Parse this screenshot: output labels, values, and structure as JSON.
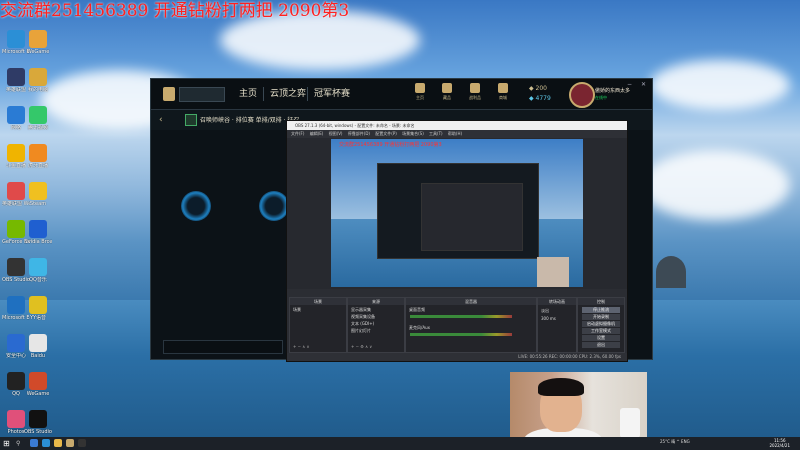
{
  "banner": "交流群251456389 开通钻粉打两把 2090第3",
  "desktop_icons": [
    {
      "label": "Microsoft Edge",
      "color": "#2b8fd6"
    },
    {
      "label": "WeGame",
      "color": "#e8a33a"
    },
    {
      "label": "英雄联盟",
      "color": "#2f3b66"
    },
    {
      "label": "我的电脑",
      "color": "#d9a83a"
    },
    {
      "label": "网络",
      "color": "#2a7bd4"
    },
    {
      "label": "腾讯视频",
      "color": "#34c86a"
    },
    {
      "label": "斗鱼直播",
      "color": "#f0b400"
    },
    {
      "label": "虎牙直播",
      "color": "#f08a20"
    },
    {
      "label": "英雄联盟 WeGame",
      "color": "#e04a4a"
    },
    {
      "label": "Steam",
      "color": "#f0c020"
    },
    {
      "label": "GeForce Experience",
      "color": "#76b900"
    },
    {
      "label": "Nvidia Broadcast",
      "color": "#1f5fd0"
    },
    {
      "label": "OBS Studio",
      "color": "#333333"
    },
    {
      "label": "QQ音乐",
      "color": "#3fb6e6"
    },
    {
      "label": "Microsoft Edge",
      "color": "#1f70c0"
    },
    {
      "label": "YY语音",
      "color": "#e0c020"
    },
    {
      "label": "安全中心",
      "color": "#2a6ad0"
    },
    {
      "label": "Baidu",
      "color": "#e6e6e6"
    },
    {
      "label": "QQ",
      "color": "#222222"
    },
    {
      "label": "WeGame",
      "color": "#d14a2a"
    },
    {
      "label": "Photos",
      "color": "#e0507a"
    },
    {
      "label": "OBS Studio",
      "color": "#111111"
    }
  ],
  "client": {
    "search_placeholder": "",
    "nav": [
      "主页",
      "云顶之弈",
      "冠军杯赛"
    ],
    "top_icons": [
      "主页",
      "藏品",
      "战利品",
      "商城"
    ],
    "currency_blue": "200",
    "currency_orange": "4779",
    "player_name": "傲娇的东西太多",
    "player_status": "在线中",
    "mode_title": "召唤师峡谷 · 排位赛 单排/双排 · 征召",
    "chat_label": ""
  },
  "obs": {
    "title": "OBS 27.1.3 (64-bit, windows) - 配置文件: 未命名 - 场景: 未命名",
    "menu": [
      "文件(F)",
      "编辑(E)",
      "视图(V)",
      "停靠部件(D)",
      "配置文件(P)",
      "场景集合(S)",
      "工具(T)",
      "帮助(H)"
    ],
    "panel_titles": [
      "场景",
      "来源",
      "混音器",
      "转场动画",
      "控制"
    ],
    "scene_items": [
      "场景"
    ],
    "source_items": [
      "显示器采集",
      "视频采集设备",
      "文本 (GDI+)",
      "图片幻灯片"
    ],
    "mixer_tracks": [
      "桌面音频",
      "麦克风/Aux"
    ],
    "transition": "淡出",
    "duration": "300 ms",
    "controls": [
      "停止推流",
      "开始录制",
      "启动虚拟摄像机",
      "工作室模式",
      "设置",
      "退出"
    ],
    "status": "LIVE: 00:55:26  REC: 00:00:00  CPU: 2.3%, 60.00 fps",
    "preview_banner": "交流群251456389 开通钻粉打两把 2090第3"
  },
  "taskbar": {
    "search_glyph": "⚲",
    "tray_text": "25°C 晴  ^  ENG",
    "time": "11:56",
    "date": "2022/4/21"
  }
}
